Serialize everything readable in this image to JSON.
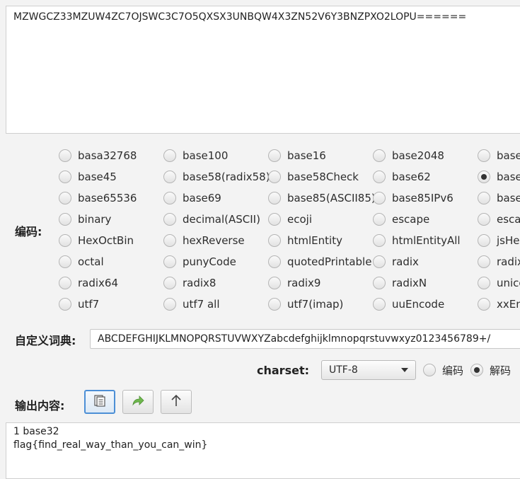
{
  "input": {
    "value": "MZWGCZ33MZUW4ZC7OJSWC3C7O5QXSX3UNBQW4X3ZN52V6Y3BNZPXO2LOPU======"
  },
  "encode_label": "编码:",
  "encodings": [
    [
      "basa32768",
      "base100",
      "base16",
      "base2048",
      "base"
    ],
    [
      "base45",
      "base58(radix58)",
      "base58Check",
      "base62",
      "base"
    ],
    [
      "base65536",
      "base69",
      "base85(ASCII85)",
      "base85IPv6",
      "base"
    ],
    [
      "binary",
      "decimal(ASCII)",
      "ecoji",
      "escape",
      "esca"
    ],
    [
      "HexOctBin",
      "hexReverse",
      "htmlEntity",
      "htmlEntityAll",
      "jsHe"
    ],
    [
      "octal",
      "punyCode",
      "quotedPrintable",
      "radix",
      "radix"
    ],
    [
      "radix64",
      "radix8",
      "radix9",
      "radixN",
      "unico"
    ],
    [
      "utf7",
      "utf7 all",
      "utf7(imap)",
      "uuEncode",
      "xxEn"
    ]
  ],
  "selected_encoding": "1,4",
  "dict": {
    "label": "自定义词典:",
    "value": "ABCDEFGHIJKLMNOPQRSTUVWXYZabcdefghijklmnopqrstuvwxyz0123456789+/"
  },
  "charset": {
    "label": "charset:",
    "value": "UTF-8",
    "mode_encode": "编码",
    "mode_decode": "解码",
    "selected_mode": "decode"
  },
  "output": {
    "label": "输出内容:",
    "value": "1 base32\nflag{find_real_way_than_you_can_win}"
  },
  "toolbar": {
    "copy_icon": "copy-icon",
    "forward_icon": "forward-arrow-icon",
    "up_icon": "up-arrow-icon",
    "copy_accent": "#4c8fd6",
    "forward_color": "#5aa83c"
  }
}
